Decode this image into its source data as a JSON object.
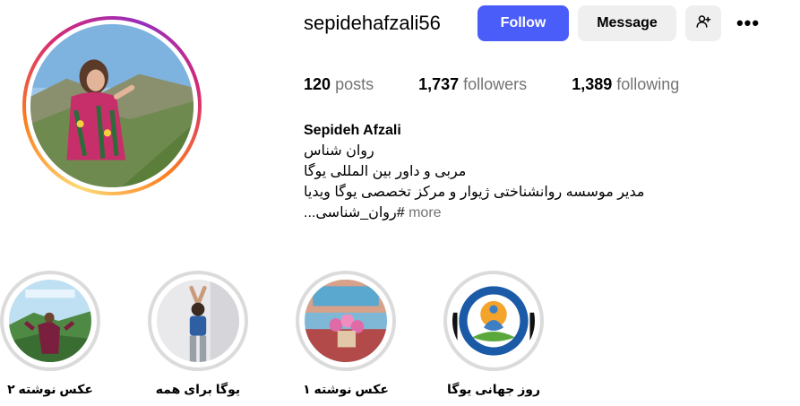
{
  "profile": {
    "username": "sepidehafzali56",
    "follow_label": "Follow",
    "message_label": "Message",
    "more_label": "•••",
    "posts_count": "120",
    "posts_label": "posts",
    "followers_count": "1,737",
    "followers_label": "followers",
    "following_count": "1,389",
    "following_label": "following"
  },
  "bio": {
    "name": "Sepideh Afzali",
    "line1": "روان شناس",
    "line2": "مربی و داور بین المللی یوگا",
    "line3": "مدیر موسسه روانشناختی ژیوار و مرکز تخصصی یوگا ویدیا",
    "line4": "#روان_شناسی...",
    "more": "more"
  },
  "highlights": [
    {
      "label": "عکس نوشته ۲",
      "icon": "highlight-landscape"
    },
    {
      "label": "یوگا برای همه",
      "icon": "highlight-yoga-pose"
    },
    {
      "label": "عکس نوشته ۱",
      "icon": "highlight-flowers"
    },
    {
      "label": "روز جهانی یوگا",
      "icon": "highlight-yoga-day"
    }
  ],
  "colors": {
    "accent": "#4a5df9",
    "secondary_button": "#efefef",
    "muted_text": "#737373",
    "highlight_ring": "#dbdbdb"
  }
}
